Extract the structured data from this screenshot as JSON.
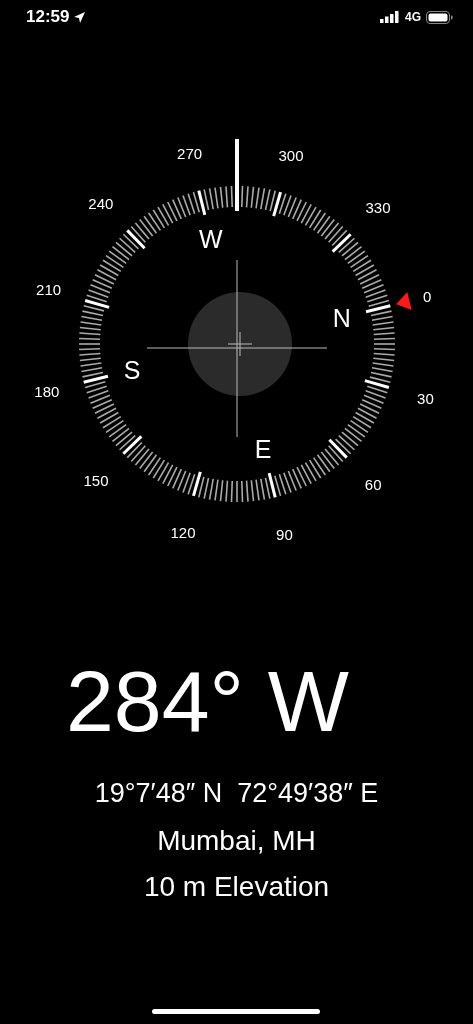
{
  "status_bar": {
    "time": "12:59",
    "network": "4G"
  },
  "compass": {
    "degree_labels": [
      "0",
      "30",
      "60",
      "90",
      "120",
      "150",
      "180",
      "210",
      "240",
      "270",
      "300",
      "330"
    ],
    "cardinals": [
      "N",
      "E",
      "S",
      "W"
    ]
  },
  "heading": "284° W",
  "coordinates": "19°7′48″ N  72°49′38″ E",
  "place": "Mumbai, MH",
  "elevation": "10 m Elevation"
}
